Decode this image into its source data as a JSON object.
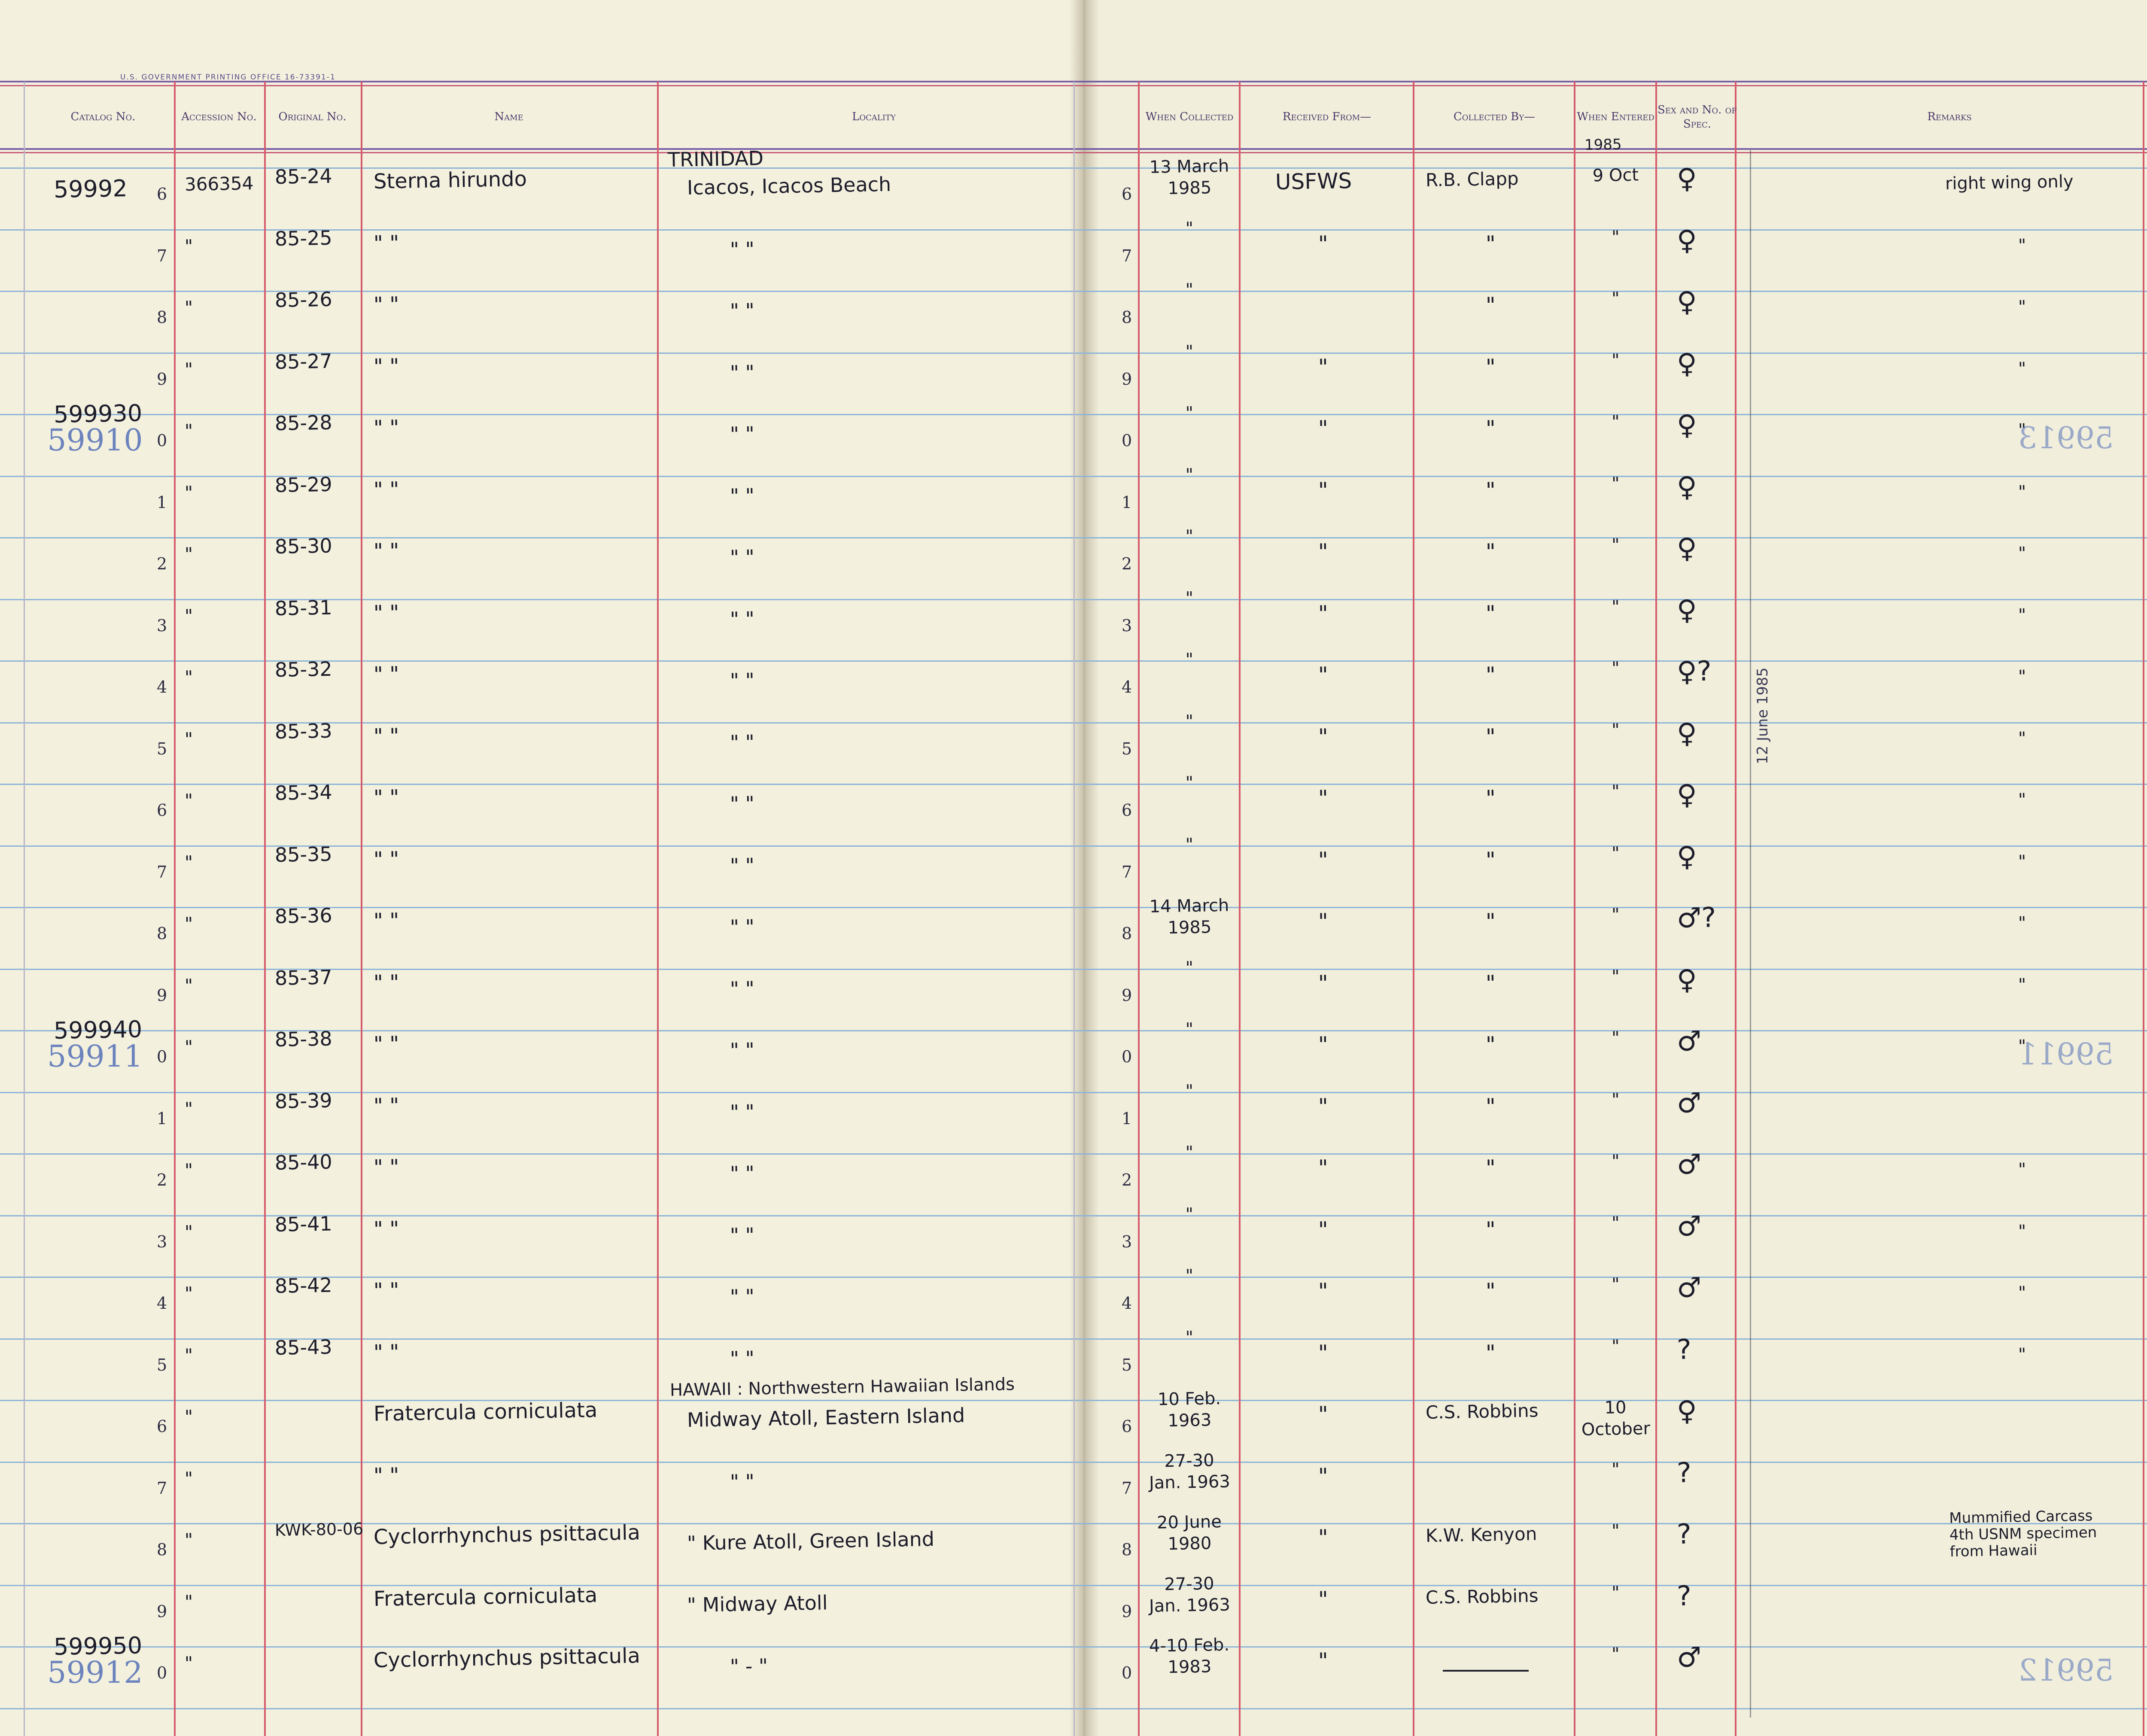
{
  "header": {
    "printer_line": "U.S. GOVERNMENT PRINTING OFFICE   16-73391-1",
    "columns": {
      "catalog": "Catalog No.",
      "accession": "Accession No.",
      "original": "Original No.",
      "name": "Name",
      "locality": "Locality",
      "when_collected": "When Collected",
      "received_from": "Received From—",
      "collected_by": "Collected By—",
      "when_entered": "When Entered",
      "sex": "Sex and No. of Spec.",
      "remarks": "Remarks"
    }
  },
  "row_digits": [
    "6",
    "7",
    "8",
    "9",
    "0",
    "1",
    "2",
    "3",
    "4",
    "5",
    "6",
    "7",
    "8",
    "9",
    "0",
    "1",
    "2",
    "3",
    "4",
    "5",
    "6",
    "7",
    "8",
    "9",
    "0"
  ],
  "catalog_numbers": [
    {
      "row": 0,
      "text": "59992"
    },
    {
      "row": 4,
      "text": "599930"
    },
    {
      "row": 14,
      "text": "599940"
    },
    {
      "row": 24,
      "text": "599950"
    }
  ],
  "stamps": [
    {
      "row": 4,
      "text": "59910"
    },
    {
      "row": 14,
      "text": "59911"
    },
    {
      "row": 24,
      "text": "59912"
    }
  ],
  "right_stamps": [
    {
      "row": 4,
      "text": "59913"
    },
    {
      "row": 14,
      "text": "59911"
    },
    {
      "row": 24,
      "text": "59912"
    }
  ],
  "header_extras": {
    "locality_country": "TRINIDAD",
    "entered_year": "1985"
  },
  "rows": [
    {
      "accession": "366354",
      "original": "85-24",
      "name": "Sterna hirundo",
      "locality": "Icacos, Icacos Beach",
      "when_collected": "13 March 1985",
      "received_from": "USFWS",
      "collected_by": "R.B. Clapp",
      "when_entered": "9 Oct",
      "sex": "♀",
      "remarks": "right wing only"
    },
    {
      "accession": "\"",
      "original": "85-25",
      "name": "\"      \"",
      "locality": "\"        \"",
      "when_collected": "\"",
      "received_from": "\"",
      "collected_by": "\"",
      "when_entered": "\"",
      "sex": "♀",
      "remarks": "\""
    },
    {
      "accession": "\"",
      "original": "85-26",
      "name": "\"      \"",
      "locality": "\"        \"",
      "when_collected": "\"",
      "received_from": "",
      "collected_by": "\"",
      "when_entered": "\"",
      "sex": "♀",
      "remarks": "\""
    },
    {
      "accession": "\"",
      "original": "85-27",
      "name": "\"      \"",
      "locality": "\"        \"",
      "when_collected": "\"",
      "received_from": "\"",
      "collected_by": "\"",
      "when_entered": "\"",
      "sex": "♀",
      "remarks": "\""
    },
    {
      "accession": "\"",
      "original": "85-28",
      "name": "\"      \"",
      "locality": "\"        \"",
      "when_collected": "\"",
      "received_from": "\"",
      "collected_by": "\"",
      "when_entered": "\"",
      "sex": "♀",
      "remarks": "\""
    },
    {
      "accession": "\"",
      "original": "85-29",
      "name": "\"      \"",
      "locality": "\"        \"",
      "when_collected": "\"",
      "received_from": "\"",
      "collected_by": "\"",
      "when_entered": "\"",
      "sex": "♀",
      "remarks": "\""
    },
    {
      "accession": "\"",
      "original": "85-30",
      "name": "\"      \"",
      "locality": "\"        \"",
      "when_collected": "\"",
      "received_from": "\"",
      "collected_by": "\"",
      "when_entered": "\"",
      "sex": "♀",
      "remarks": "\""
    },
    {
      "accession": "\"",
      "original": "85-31",
      "name": "\"      \"",
      "locality": "\"        \"",
      "when_collected": "\"",
      "received_from": "\"",
      "collected_by": "\"",
      "when_entered": "\"",
      "sex": "♀",
      "remarks": "\""
    },
    {
      "accession": "\"",
      "original": "85-32",
      "name": "\"      \"",
      "locality": "\"        \"",
      "when_collected": "\"",
      "received_from": "\"",
      "collected_by": "\"",
      "when_entered": "\"",
      "sex": "♀?",
      "remarks": "\""
    },
    {
      "accession": "\"",
      "original": "85-33",
      "name": "\"      \"",
      "locality": "\"        \"",
      "when_collected": "\"",
      "received_from": "\"",
      "collected_by": "\"",
      "when_entered": "\"",
      "sex": "♀",
      "remarks": "\""
    },
    {
      "accession": "\"",
      "original": "85-34",
      "name": "\"      \"",
      "locality": "\"        \"",
      "when_collected": "\"",
      "received_from": "\"",
      "collected_by": "\"",
      "when_entered": "\"",
      "sex": "♀",
      "remarks": "\""
    },
    {
      "accession": "\"",
      "original": "85-35",
      "name": "\"      \"",
      "locality": "\"        \"",
      "when_collected": "\"",
      "received_from": "\"",
      "collected_by": "\"",
      "when_entered": "\"",
      "sex": "♀",
      "remarks": "\""
    },
    {
      "accession": "\"",
      "original": "85-36",
      "name": "\"      \"",
      "locality": "\"        \"",
      "when_collected": "14 March 1985",
      "received_from": "\"",
      "collected_by": "\"",
      "when_entered": "\"",
      "sex": "♂?",
      "remarks": "\""
    },
    {
      "accession": "\"",
      "original": "85-37",
      "name": "\"      \"",
      "locality": "\"        \"",
      "when_collected": "\"",
      "received_from": "\"",
      "collected_by": "\"",
      "when_entered": "\"",
      "sex": "♀",
      "remarks": "\""
    },
    {
      "accession": "\"",
      "original": "85-38",
      "name": "\"      \"",
      "locality": "\"        \"",
      "when_collected": "\"",
      "received_from": "\"",
      "collected_by": "\"",
      "when_entered": "\"",
      "sex": "♂",
      "remarks": "\""
    },
    {
      "accession": "\"",
      "original": "85-39",
      "name": "\"      \"",
      "locality": "\"        \"",
      "when_collected": "\"",
      "received_from": "\"",
      "collected_by": "\"",
      "when_entered": "\"",
      "sex": "♂",
      "remarks": ""
    },
    {
      "accession": "\"",
      "original": "85-40",
      "name": "\"      \"",
      "locality": "\"        \"",
      "when_collected": "\"",
      "received_from": "\"",
      "collected_by": "\"",
      "when_entered": "\"",
      "sex": "♂",
      "remarks": "\""
    },
    {
      "accession": "\"",
      "original": "85-41",
      "name": "\"      \"",
      "locality": "\"        \"",
      "when_collected": "\"",
      "received_from": "\"",
      "collected_by": "\"",
      "when_entered": "\"",
      "sex": "♂",
      "remarks": "\""
    },
    {
      "accession": "\"",
      "original": "85-42",
      "name": "\"      \"",
      "locality": "\"        \"",
      "when_collected": "\"",
      "received_from": "\"",
      "collected_by": "\"",
      "when_entered": "\"",
      "sex": "♂",
      "remarks": "\""
    },
    {
      "accession": "\"",
      "original": "85-43",
      "name": "\"      \"",
      "locality": "\"        \"",
      "when_collected": "\"",
      "received_from": "\"",
      "collected_by": "\"",
      "when_entered": "\"",
      "sex": "?",
      "remarks": "\""
    },
    {
      "accession": "\"",
      "original": "",
      "name": "Fratercula corniculata",
      "locality_top": "HAWAII : Northwestern Hawaiian Islands",
      "locality": "Midway Atoll, Eastern Island",
      "when_collected": "10 Feb. 1963",
      "received_from": "\"",
      "collected_by": "C.S. Robbins",
      "when_entered": "10 October",
      "sex": "♀",
      "remarks": ""
    },
    {
      "accession": "\"",
      "original": "",
      "name": "\"      \"",
      "locality": "\"    \"",
      "when_collected": "27-30 Jan. 1963",
      "received_from": "\"",
      "collected_by": "",
      "when_entered": "\"",
      "sex": "?",
      "remarks": ""
    },
    {
      "accession": "\"",
      "original": "KWK-80-06",
      "name": "Cyclorrhynchus psittacula",
      "locality": "\"  Kure Atoll, Green Island",
      "when_collected": "20 June 1980",
      "received_from": "\"",
      "collected_by": "K.W. Kenyon",
      "when_entered": "\"",
      "sex": "?",
      "remarks": "Mummified Carcass 4th USNM specimen from Hawaii"
    },
    {
      "accession": "\"",
      "original": "",
      "name": "Fratercula corniculata",
      "locality": "\"  Midway Atoll",
      "when_collected": "27-30 Jan. 1963",
      "received_from": "\"",
      "collected_by": "C.S. Robbins",
      "when_entered": "\"",
      "sex": "?",
      "remarks": ""
    },
    {
      "accession": "\"",
      "original": "",
      "name": "Cyclorrhynchus psittacula",
      "locality": "\"  -      \"",
      "when_collected": "4-10 Feb. 1983",
      "received_from": "\"",
      "collected_by": "",
      "when_entered": "\"",
      "sex": "♂",
      "remarks": ""
    }
  ],
  "margin_note": "12 June 1985",
  "colors": {
    "paper": "#f3f1de",
    "rule_blue": "#8cb4d8",
    "rule_red": "#d55b6b",
    "header_purple": "#7a5fa8",
    "stamp_blue": "#5570b8"
  }
}
